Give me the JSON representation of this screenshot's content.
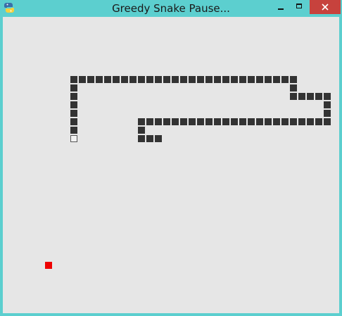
{
  "window": {
    "title": "Greedy Snake Pause...",
    "title_bar_color": "#5ccfcf",
    "close_button_color": "#c7423d",
    "icon": "python-snake-icon"
  },
  "game": {
    "state": "paused",
    "background_color": "#e6e6e6",
    "snake_color": "#333333",
    "food_color": "#ee0000",
    "head": [
      8,
      14
    ],
    "snake_body": [
      [
        8,
        13
      ],
      [
        8,
        12
      ],
      [
        8,
        11
      ],
      [
        8,
        10
      ],
      [
        8,
        9
      ],
      [
        8,
        8
      ],
      [
        8,
        7
      ],
      [
        9,
        7
      ],
      [
        10,
        7
      ],
      [
        11,
        7
      ],
      [
        12,
        7
      ],
      [
        13,
        7
      ],
      [
        14,
        7
      ],
      [
        15,
        7
      ],
      [
        16,
        7
      ],
      [
        17,
        7
      ],
      [
        18,
        7
      ],
      [
        19,
        7
      ],
      [
        20,
        7
      ],
      [
        21,
        7
      ],
      [
        22,
        7
      ],
      [
        23,
        7
      ],
      [
        24,
        7
      ],
      [
        25,
        7
      ],
      [
        26,
        7
      ],
      [
        27,
        7
      ],
      [
        28,
        7
      ],
      [
        29,
        7
      ],
      [
        30,
        7
      ],
      [
        31,
        7
      ],
      [
        32,
        7
      ],
      [
        33,
        7
      ],
      [
        34,
        7
      ],
      [
        34,
        8
      ],
      [
        34,
        9
      ],
      [
        35,
        9
      ],
      [
        36,
        9
      ],
      [
        37,
        9
      ],
      [
        38,
        9
      ],
      [
        38,
        10
      ],
      [
        38,
        11
      ],
      [
        38,
        12
      ],
      [
        37,
        12
      ],
      [
        36,
        12
      ],
      [
        35,
        12
      ],
      [
        34,
        12
      ],
      [
        33,
        12
      ],
      [
        32,
        12
      ],
      [
        31,
        12
      ],
      [
        30,
        12
      ],
      [
        29,
        12
      ],
      [
        28,
        12
      ],
      [
        27,
        12
      ],
      [
        26,
        12
      ],
      [
        25,
        12
      ],
      [
        24,
        12
      ],
      [
        23,
        12
      ],
      [
        22,
        12
      ],
      [
        21,
        12
      ],
      [
        20,
        12
      ],
      [
        19,
        12
      ],
      [
        18,
        12
      ],
      [
        17,
        12
      ],
      [
        16,
        12
      ],
      [
        16,
        13
      ],
      [
        16,
        14
      ],
      [
        17,
        14
      ],
      [
        18,
        14
      ]
    ],
    "food": [
      5,
      29
    ]
  }
}
